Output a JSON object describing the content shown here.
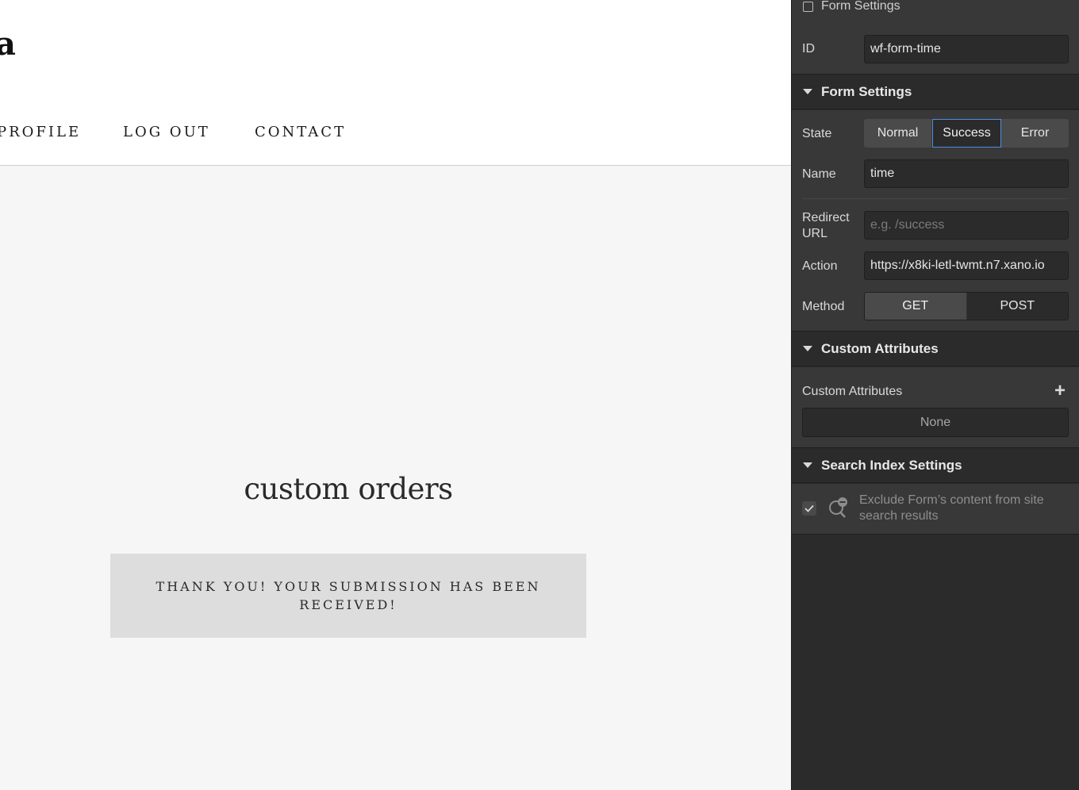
{
  "canvas": {
    "logo_fragment": "a",
    "nav": {
      "profile": "PROFILE",
      "logout": "LOG OUT",
      "contact": "CONTACT"
    },
    "section_title": "custom orders",
    "success_message": "THANK YOU! YOUR SUBMISSION HAS BEEN RECEIVED!"
  },
  "panel": {
    "top": {
      "checkbox_label": "Form Settings",
      "id_label": "ID",
      "id_value": "wf-form-time"
    },
    "form_settings": {
      "title": "Form Settings",
      "state_label": "State",
      "states": [
        "Normal",
        "Success",
        "Error"
      ],
      "active_state": "Success",
      "name_label": "Name",
      "name_value": "time",
      "redirect_label": "Redirect URL",
      "redirect_placeholder": "e.g. /success",
      "action_label": "Action",
      "action_value": "https://x8ki-letl-twmt.n7.xano.io",
      "method_label": "Method",
      "methods": [
        "GET",
        "POST"
      ],
      "active_method": "GET"
    },
    "custom_attributes": {
      "title": "Custom Attributes",
      "label": "Custom Attributes",
      "empty_text": "None"
    },
    "search_index": {
      "title": "Search Index Settings",
      "exclude_label": "Exclude Form’s content from site search results",
      "exclude_checked": true
    },
    "colors": {
      "panel_bg": "#2b2b2b",
      "block_bg": "#383838",
      "accent": "#4d8fe6"
    }
  }
}
